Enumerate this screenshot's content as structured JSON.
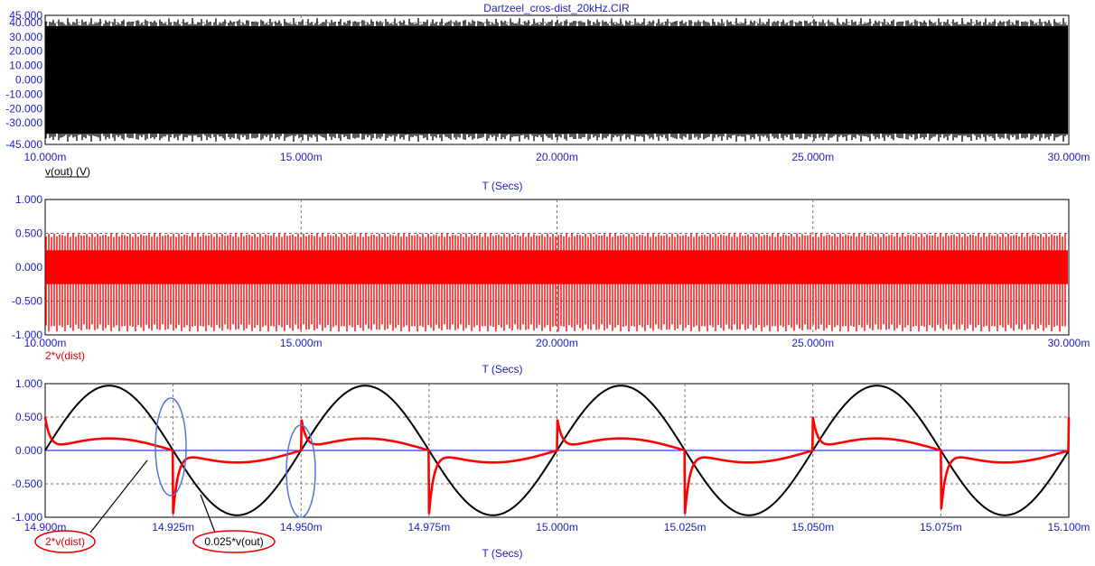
{
  "window_title": "Dartzeel_cros-dist_20kHz.CIR",
  "colors": {
    "axis_text": "#2020c8",
    "trace_black": "#000000",
    "trace_red": "#ff0000",
    "zero_line": "#0000ff",
    "highlight_ellipse": "#4a78e0",
    "annotation_ellipse": "#e00000"
  },
  "chart_data": [
    {
      "type": "line",
      "title": "Dartzeel_cros-dist_20kHz.CIR",
      "xlabel": "T (Secs)",
      "ylabel": "",
      "xlim": [
        0.01,
        0.03
      ],
      "ylim": [
        -45.0,
        45.0
      ],
      "x_ticks": [
        "10.000m",
        "15.000m",
        "20.000m",
        "25.000m",
        "30.000m"
      ],
      "y_ticks": [
        "45.000",
        "40.000",
        "30.000",
        "20.000",
        "10.000",
        "0.000",
        "-10.000",
        "-20.000",
        "-30.000",
        "-45.000"
      ],
      "grid": true,
      "series": [
        {
          "name": "v(out) (V)",
          "color": "#000000",
          "kind": "dense_sine",
          "frequency_hz": 20000,
          "amplitude": 40.0,
          "offset": 0
        }
      ]
    },
    {
      "type": "line",
      "title": "",
      "xlabel": "T (Secs)",
      "ylabel": "",
      "xlim": [
        0.01,
        0.03
      ],
      "ylim": [
        -1.0,
        1.0
      ],
      "x_ticks": [
        "10.000m",
        "15.000m",
        "20.000m",
        "25.000m",
        "30.000m"
      ],
      "y_ticks": [
        "1.000",
        "0.500",
        "0.000",
        "-0.500",
        "-1.000"
      ],
      "grid": true,
      "series": [
        {
          "name": "2*v(dist)",
          "color": "#ff0000",
          "kind": "dense_band",
          "upper": 0.5,
          "lower": -0.95
        }
      ]
    },
    {
      "type": "line",
      "title": "",
      "xlabel": "T (Secs)",
      "ylabel": "",
      "xlim": [
        0.0149,
        0.0151
      ],
      "ylim": [
        -1.0,
        1.0
      ],
      "x_ticks": [
        "14.900m",
        "14.925m",
        "14.950m",
        "14.975m",
        "15.000m",
        "15.025m",
        "15.050m",
        "15.075m",
        "15.100m"
      ],
      "y_ticks": [
        "1.000",
        "0.500",
        "0.000",
        "-0.500",
        "-1.000"
      ],
      "grid": true,
      "series": [
        {
          "name": "0.025*v(out)",
          "color": "#000000",
          "kind": "sine",
          "frequency_hz": 20000,
          "amplitude": 0.97
        },
        {
          "name": "2*v(dist)",
          "color": "#ff0000",
          "kind": "crossover_distortion",
          "peak": 0.5,
          "trough": -0.95,
          "baseline_hump": 0.18
        }
      ],
      "annotations": [
        "2*v(dist)",
        "0.025*v(out)"
      ]
    }
  ]
}
